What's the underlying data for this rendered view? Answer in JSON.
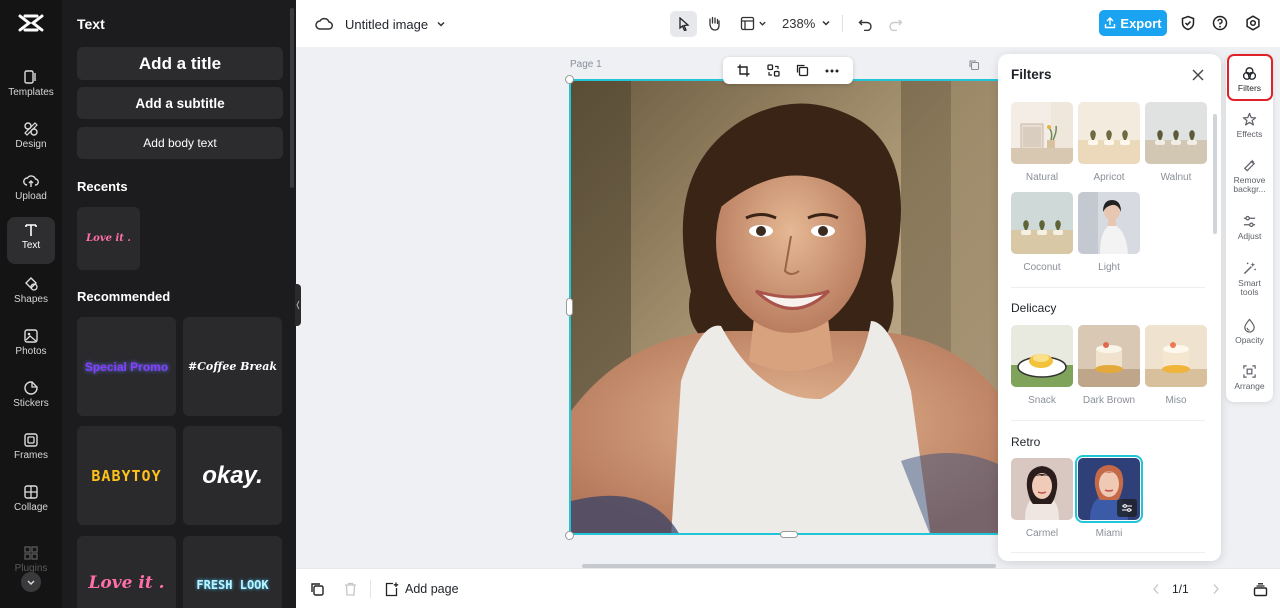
{
  "rail": {
    "items": [
      {
        "label": "Templates"
      },
      {
        "label": "Design"
      },
      {
        "label": "Upload"
      },
      {
        "label": "Text"
      },
      {
        "label": "Shapes"
      },
      {
        "label": "Photos"
      },
      {
        "label": "Stickers"
      },
      {
        "label": "Frames"
      },
      {
        "label": "Collage"
      },
      {
        "label": "Plugins"
      }
    ]
  },
  "text_panel": {
    "title": "Text",
    "add_title": "Add a title",
    "add_subtitle": "Add a subtitle",
    "add_body": "Add body text",
    "recents_heading": "Recents",
    "recent_tile": "Love it .",
    "recommended_heading": "Recommended",
    "tiles": [
      "Special Promo",
      "#Coffee Break",
      "BABYTOY",
      "okay.",
      "Love it .",
      "FRESH LOOK"
    ]
  },
  "topbar": {
    "doc_title": "Untitled image",
    "zoom": "238%",
    "export_label": "Export"
  },
  "canvas": {
    "page_label": "Page 1"
  },
  "filters": {
    "title": "Filters",
    "basic": [
      "Natural",
      "Apricot",
      "Walnut",
      "Coconut",
      "Light"
    ],
    "delicacy_heading": "Delicacy",
    "delicacy": [
      "Snack",
      "Dark Brown",
      "Miso"
    ],
    "retro_heading": "Retro",
    "retro": [
      "Carmel",
      "Miami"
    ]
  },
  "right_rail": {
    "items": [
      {
        "label": "Filters"
      },
      {
        "label": "Effects"
      },
      {
        "label": "Remove backgr..."
      },
      {
        "label": "Adjust"
      },
      {
        "label": "Smart tools"
      },
      {
        "label": "Opacity"
      },
      {
        "label": "Arrange"
      }
    ]
  },
  "bottombar": {
    "add_page": "Add page",
    "page_count": "1/1"
  },
  "colors": {
    "accent": "#1aa3f0",
    "selection": "#22c5d8",
    "highlight": "#e0212a"
  }
}
